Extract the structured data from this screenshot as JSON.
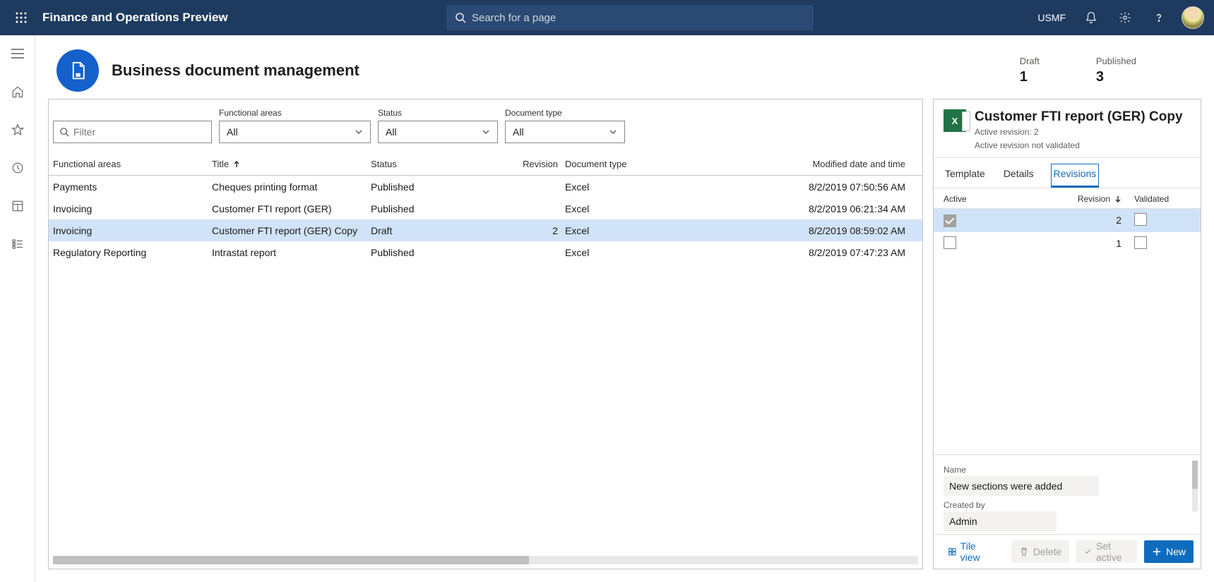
{
  "topbar": {
    "app_title": "Finance and Operations Preview",
    "search_placeholder": "Search for a page",
    "legal_entity": "USMF"
  },
  "page": {
    "title": "Business document management",
    "stats": {
      "draft_label": "Draft",
      "draft_value": "1",
      "published_label": "Published",
      "published_value": "3"
    }
  },
  "filters": {
    "filter_placeholder": "Filter",
    "functional_areas_label": "Functional areas",
    "functional_areas_value": "All",
    "status_label": "Status",
    "status_value": "All",
    "document_type_label": "Document type",
    "document_type_value": "All"
  },
  "grid": {
    "columns": {
      "functional_areas": "Functional areas",
      "title": "Title",
      "status": "Status",
      "revision": "Revision",
      "document_type": "Document type",
      "modified": "Modified date and time"
    },
    "rows": [
      {
        "fa": "Payments",
        "title": "Cheques printing format",
        "status": "Published",
        "revision": "",
        "doctype": "Excel",
        "modified": "8/2/2019 07:50:56 AM"
      },
      {
        "fa": "Invoicing",
        "title": "Customer FTI report (GER)",
        "status": "Published",
        "revision": "",
        "doctype": "Excel",
        "modified": "8/2/2019 06:21:34 AM"
      },
      {
        "fa": "Invoicing",
        "title": "Customer FTI report (GER) Copy",
        "status": "Draft",
        "revision": "2",
        "doctype": "Excel",
        "modified": "8/2/2019 08:59:02 AM"
      },
      {
        "fa": "Regulatory Reporting",
        "title": "Intrastat report",
        "status": "Published",
        "revision": "",
        "doctype": "Excel",
        "modified": "8/2/2019 07:47:23 AM"
      }
    ],
    "selected_index": 2
  },
  "detail": {
    "title": "Customer FTI report (GER) Copy",
    "active_revision_line": "Active revision: 2",
    "validation_line": "Active revision not validated",
    "tabs": {
      "template": "Template",
      "details": "Details",
      "revisions": "Revisions"
    },
    "active_tab": "revisions",
    "rev_columns": {
      "active": "Active",
      "revision": "Revision",
      "validated": "Validated"
    },
    "rev_rows": [
      {
        "active": true,
        "revision": "2",
        "validated": false
      },
      {
        "active": false,
        "revision": "1",
        "validated": false
      }
    ],
    "rev_selected_index": 0,
    "form": {
      "name_label": "Name",
      "name_value": "New sections were added",
      "created_by_label": "Created by",
      "created_by_value": "Admin"
    },
    "actions": {
      "tile_view": "Tile view",
      "delete": "Delete",
      "set_active": "Set active",
      "new": "New"
    }
  }
}
